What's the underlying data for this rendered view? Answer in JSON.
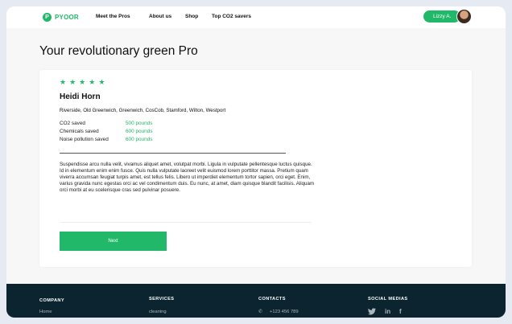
{
  "nav": {
    "logo_mark": "P",
    "logo_text": "PYOOR",
    "links": [
      "Meet the Pros",
      "About us",
      "Shop",
      "Top CO2 savers"
    ],
    "user_name": "Lizzy A."
  },
  "page": {
    "title": "Your revolutionary green Pro"
  },
  "pro": {
    "rating": 5,
    "stars": [
      "★",
      "★",
      "★",
      "★",
      "★"
    ],
    "name": "Heidi Horn",
    "areas": "Riverside, Old Greenwich, Greenwich, CosCob, Stamford, Wilton, Westport",
    "stats": [
      {
        "label": "CO2 saved",
        "value": "500 pounds"
      },
      {
        "label": "Chemicals saved",
        "value": "600 pounds"
      },
      {
        "label": "Noise pollution saved",
        "value": "600 pounds"
      }
    ],
    "description": "Suspendisse arcu nulla velit, vivamus aliquet amet, volutpat morbi. Ligula in vulputate pellentesque luctus quisque. Id in elementum enim enim fusce. Quis nulla vulputate laoreet velit euismod lorem porttitor massa. Pretium quam viverra accumsan feugiat turpis amet, est tellus felis. Libero ut imperdiet elementum tortor sapien, orci eget. Enim, varius gravida nunc egestas orci ac vel condimentum duis. Eu nunc, at amet, diam quisque blandit facilisis. Aliquam orci morbi at eu scelerisque cras sed pulvinar posuere.",
    "next_label": "Next"
  },
  "footer": {
    "company_heading": "COMPANY",
    "company_item": "Home",
    "services_heading": "SERVICES",
    "services_item": "cleaning",
    "contacts_heading": "CONTACTS",
    "contacts_phone": "+123 456 789",
    "social_heading": "SOCIAL MEDIAS",
    "social_icons": [
      "twitter-icon",
      "linkedin-icon",
      "facebook-icon"
    ]
  },
  "colors": {
    "accent": "#22b86a",
    "footer_bg": "#0c2430",
    "page_bg": "#f7f7f8"
  }
}
